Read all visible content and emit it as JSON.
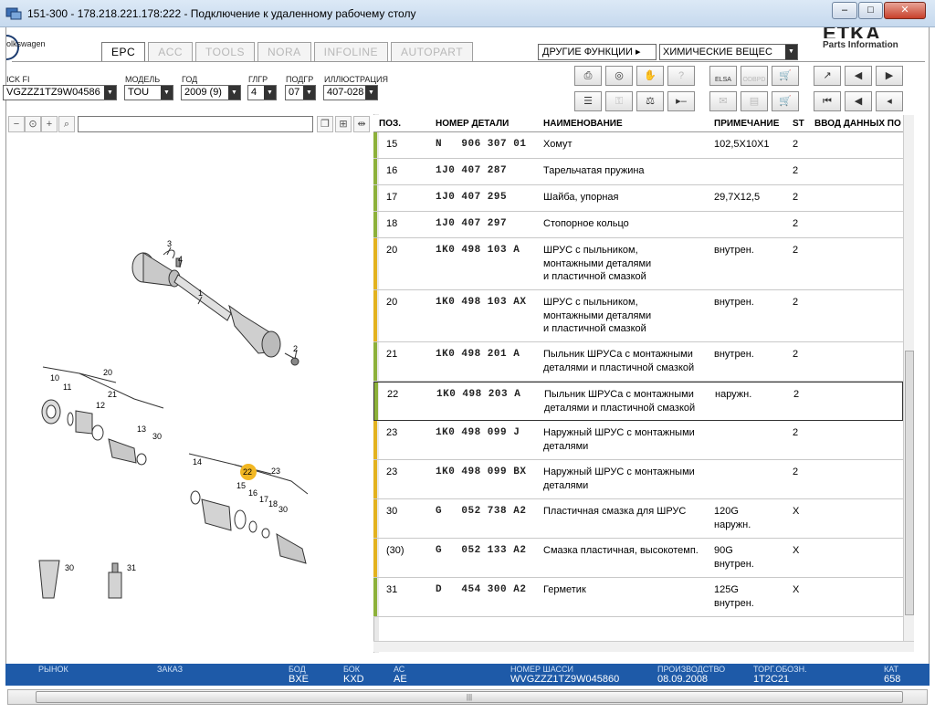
{
  "window": {
    "title": "151-300 - 178.218.221.178:222 - Подключение к удаленному рабочему столу"
  },
  "branding": {
    "left_brand": "olkswagen",
    "right_logo": "ETKA",
    "right_sub": "Parts Information"
  },
  "tabs": [
    "EPC",
    "ACC",
    "TOOLS",
    "NORA",
    "INFOLINE",
    "AUTOPART"
  ],
  "other_functions": "ДРУГИЕ ФУНКЦИИ ▸",
  "chem_select": "ХИМИЧЕСКИЕ ВЕЩЕС",
  "selectors": [
    {
      "label": "ICK FI",
      "value": "VGZZZ1TZ9W04586"
    },
    {
      "label": "МОДЕЛЬ",
      "value": "TOU"
    },
    {
      "label": "ГОД",
      "value": "2009 (9)"
    },
    {
      "label": "ГЛГР",
      "value": "4"
    },
    {
      "label": "ПОДГР",
      "value": "07"
    },
    {
      "label": "ИЛЛЮСТРАЦИЯ",
      "value": "407-028"
    }
  ],
  "toolbar_icons": [
    "print-icon",
    "disc-icon",
    "handshake-icon",
    "help-icon",
    "elsa-icon",
    "odbpd-icon",
    "cart-icon",
    "pin-icon",
    "book-prev-icon",
    "book-next-icon",
    "list-icon",
    "key-icon",
    "scale-icon",
    "forward-minus-icon",
    "first-icon",
    "prev-icon",
    "back-icon"
  ],
  "toolbar_labels": {
    "elsa": "ELSA",
    "odbpd": "ODBPD"
  },
  "table": {
    "headers": [
      "ПОЗ.",
      "НОМЕР ДЕТАЛИ",
      "НАИМЕНОВАНИЕ",
      "ПРИМЕЧАНИЕ",
      "ST",
      "ВВОД ДАННЫХ ПО"
    ],
    "rows": [
      {
        "pos": "15",
        "part": "N   906 307 01",
        "name": "Хомут",
        "note": "102,5X10X1",
        "st": "2",
        "bar": "#8db13a"
      },
      {
        "pos": "16",
        "part": "1J0 407 287",
        "name": "Тарельчатая пружина",
        "note": "",
        "st": "2",
        "bar": "#8db13a"
      },
      {
        "pos": "17",
        "part": "1J0 407 295",
        "name": "Шайба, упорная",
        "note": "29,7X12,5",
        "st": "2",
        "bar": "#8db13a"
      },
      {
        "pos": "18",
        "part": "1J0 407 297",
        "name": "Стопорное кольцо",
        "note": "",
        "st": "2",
        "bar": "#8db13a"
      },
      {
        "pos": "20",
        "part": "1K0 498 103 A",
        "name": "ШРУС с пыльником,\nмонтажными деталями\nи пластичной смазкой",
        "note": "внутрен.",
        "st": "2",
        "bar": "#e3b21e"
      },
      {
        "pos": "20",
        "part": "1K0 498 103 AX",
        "name": "ШРУС с пыльником,\nмонтажными деталями\nи пластичной смазкой",
        "note": "внутрен.",
        "st": "2",
        "bar": "#e3b21e"
      },
      {
        "pos": "21",
        "part": "1K0 498 201 A",
        "name": "Пыльник ШРУСа с монтажными\nдеталями и пластичной смазкой",
        "note": "внутрен.",
        "st": "2",
        "bar": "#8db13a"
      },
      {
        "pos": "22",
        "part": "1K0 498 203 A",
        "name": "Пыльник ШРУСа с монтажными\nдеталями и пластичной смазкой",
        "note": "наружн.",
        "st": "2",
        "bar": "#8db13a",
        "selected": true
      },
      {
        "pos": "23",
        "part": "1K0 498 099 J",
        "name": "Наружный ШРУС с монтажными\nдеталями",
        "note": "",
        "st": "2",
        "bar": "#e3b21e"
      },
      {
        "pos": "23",
        "part": "1K0 498 099 BX",
        "name": "Наружный ШРУС с монтажными\nдеталями",
        "note": "",
        "st": "2",
        "bar": "#e3b21e"
      },
      {
        "pos": "30",
        "part": "G   052 738 A2",
        "name": "Пластичная смазка для ШРУС",
        "note": "120G\nнаружн.",
        "st": "X",
        "bar": "#e3b21e"
      },
      {
        "pos": "(30)",
        "part": "G   052 133 A2",
        "name": "Смазка пластичная, высокотемп.",
        "note": "90G\nвнутрен.",
        "st": "X",
        "bar": "#e3b21e"
      },
      {
        "pos": "31",
        "part": "D   454 300 A2",
        "name": "Герметик",
        "note": "125G\nвнутрен.",
        "st": "X",
        "bar": "#8db13a"
      }
    ]
  },
  "illustration": {
    "callouts": [
      "1",
      "2",
      "3",
      "4",
      "10",
      "11",
      "12",
      "13",
      "14",
      "15",
      "16",
      "17",
      "18",
      "20",
      "21",
      "22",
      "23",
      "30",
      "30",
      "31"
    ],
    "highlight": "22"
  },
  "status": [
    {
      "label": "РЫНОК",
      "value": ""
    },
    {
      "label": "ЗАКАЗ",
      "value": ""
    },
    {
      "label": "БОД",
      "value": "BXE"
    },
    {
      "label": "БОК",
      "value": "KXD"
    },
    {
      "label": "АС",
      "value": "AE"
    },
    {
      "label": "НОМЕР ШАССИ",
      "value": "WVGZZZ1TZ9W045860"
    },
    {
      "label": "ПРОИЗВОДСТВО",
      "value": "08.09.2008"
    },
    {
      "label": "ТОРГ.ОБОЗН.",
      "value": "1T2C21"
    },
    {
      "label": "КАТ",
      "value": "658"
    }
  ],
  "colors": {
    "status_bg": "#1e5aa8",
    "bar_green": "#8db13a",
    "bar_yellow": "#e3b21e",
    "highlight": "#f2b722"
  }
}
